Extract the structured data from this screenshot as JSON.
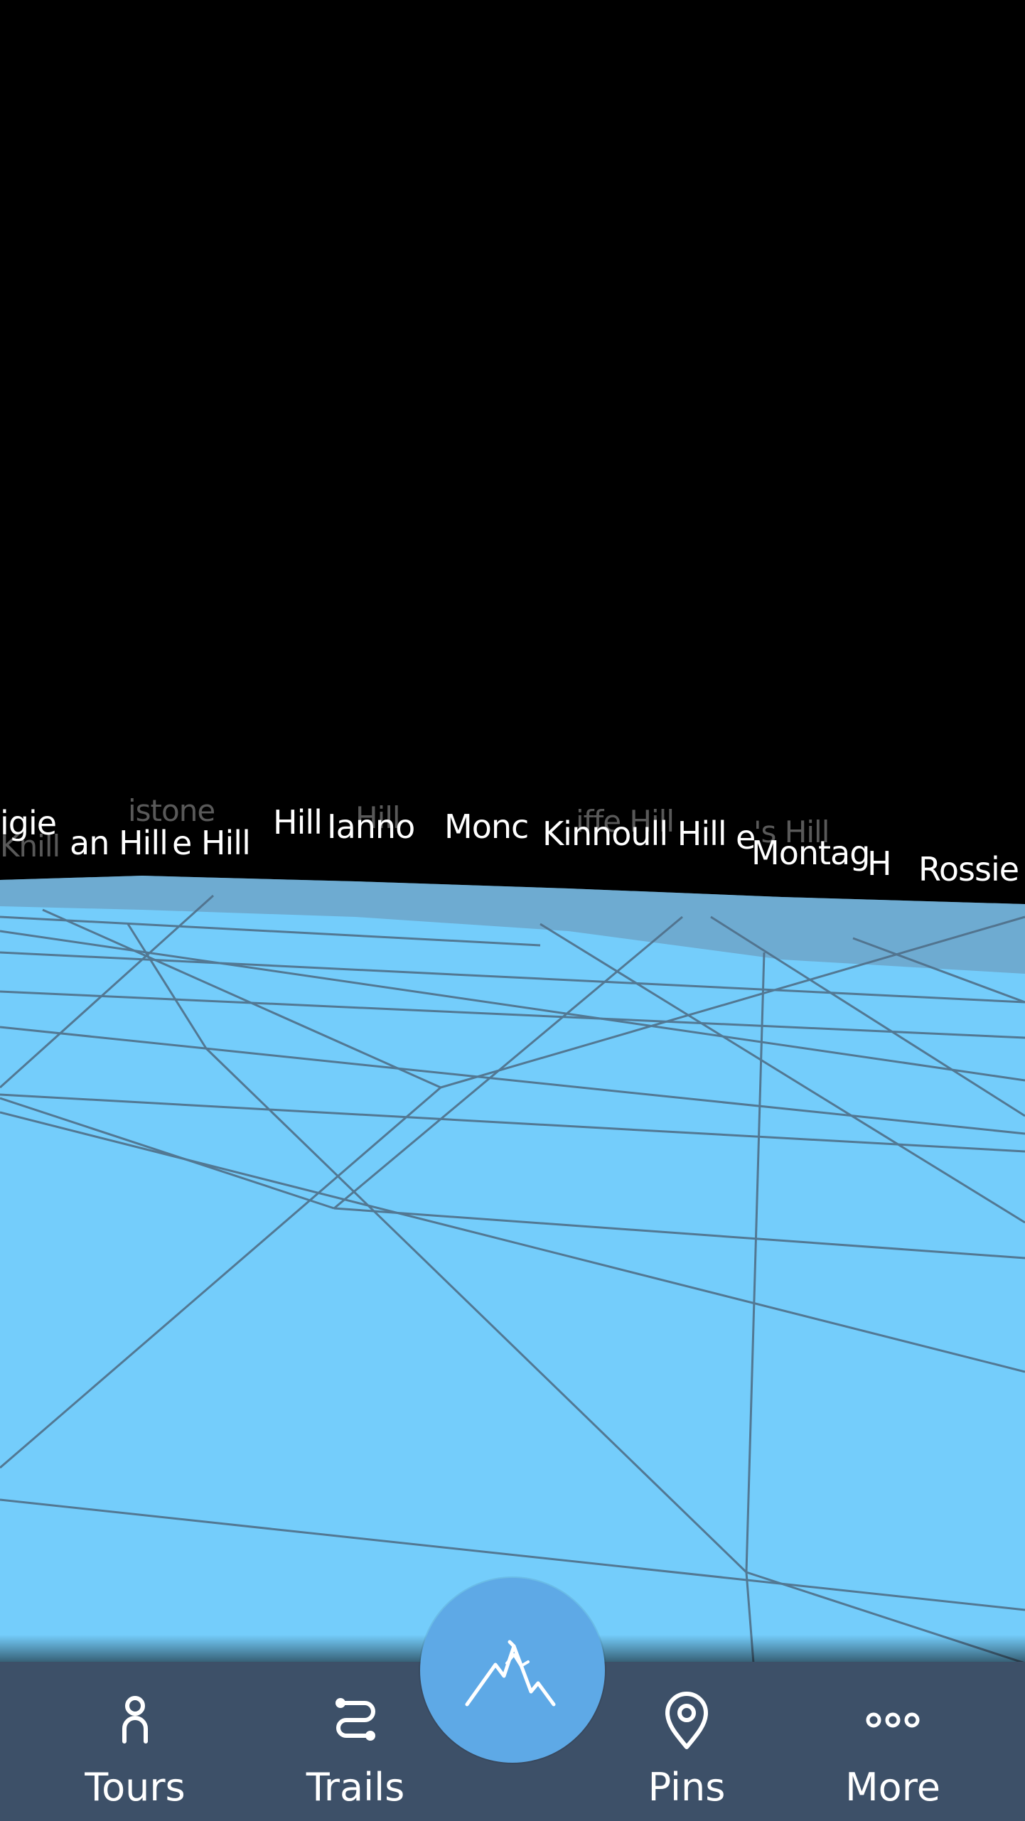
{
  "viewport": {
    "sky_color": "#000000",
    "terrain_color": "#74cdfb",
    "grid_color": "#4f6f88",
    "peak_labels": [
      {
        "text": "igie",
        "faint": false
      },
      {
        "text": "an Hill",
        "faint": false
      },
      {
        "text": "e Hill",
        "faint": false
      },
      {
        "text": "Hill",
        "faint": false
      },
      {
        "text": "Ianno",
        "faint": false
      },
      {
        "text": "Monc",
        "faint": false
      },
      {
        "text": "Kinnoull Hill",
        "faint": false
      },
      {
        "text": "e",
        "faint": false
      },
      {
        "text": "Montag",
        "faint": false
      },
      {
        "text": "H",
        "faint": false
      },
      {
        "text": "Rossie",
        "faint": false
      },
      {
        "text": "istone",
        "faint": true
      },
      {
        "text": "Knill",
        "faint": true
      },
      {
        "text": "Hill",
        "faint": true
      },
      {
        "text": "iffe Hill",
        "faint": true
      },
      {
        "text": "'s Hill",
        "faint": true
      }
    ]
  },
  "fab": {
    "icon": "mountain-icon",
    "color": "#5ea9e6"
  },
  "nav": {
    "background": "#3d5068",
    "items": [
      {
        "label": "Tours",
        "icon": "person-icon"
      },
      {
        "label": "Trails",
        "icon": "route-icon"
      },
      {
        "label": "Pins",
        "icon": "map-pin-icon"
      },
      {
        "label": "More",
        "icon": "more-dots-icon"
      }
    ]
  }
}
